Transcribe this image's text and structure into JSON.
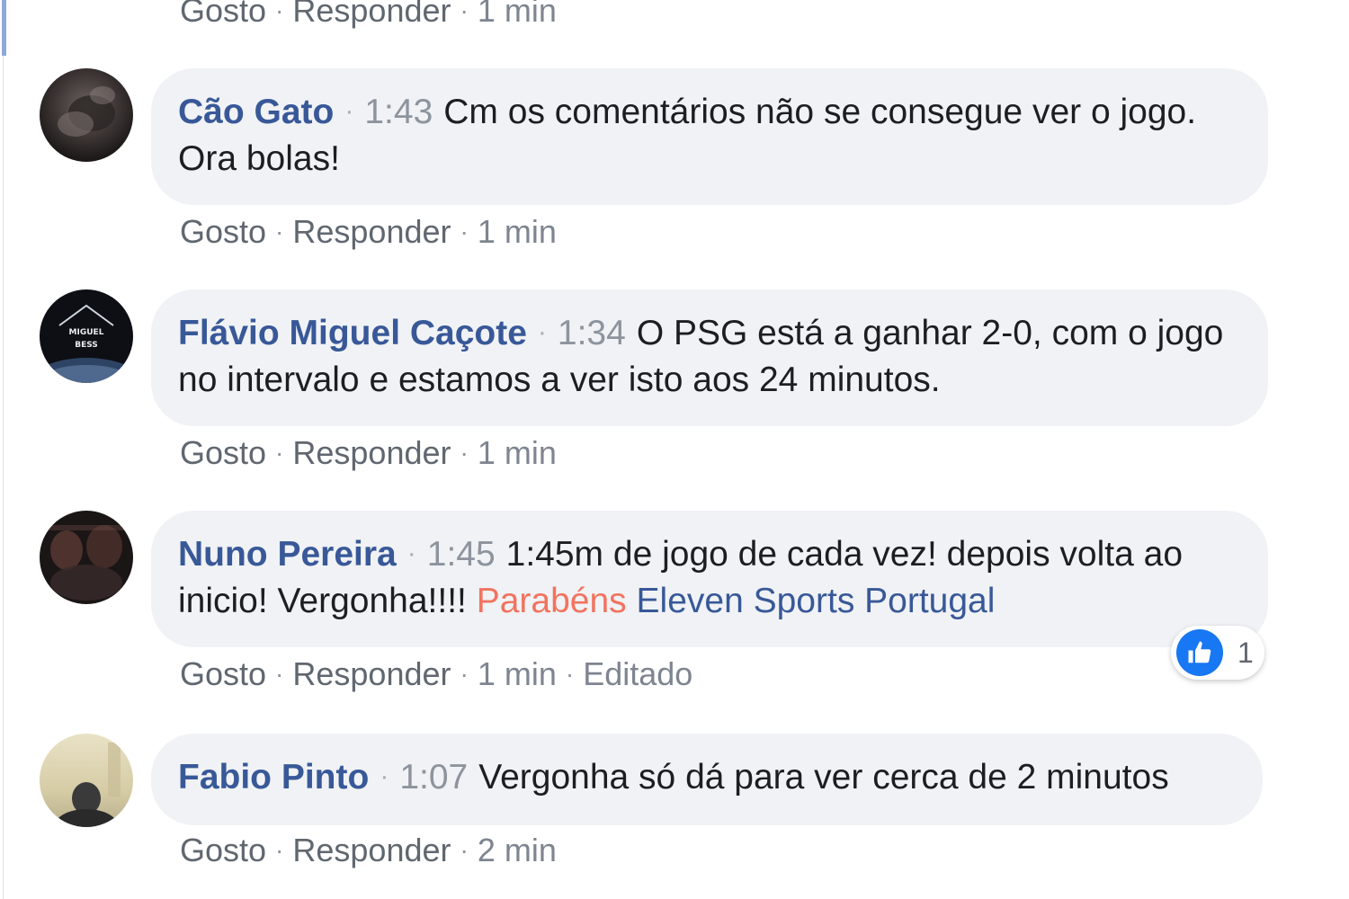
{
  "actions": {
    "like": "Gosto",
    "reply": "Responder",
    "separator": "·"
  },
  "top_partial": {
    "time_ago": "1 min"
  },
  "comments": [
    {
      "author": "Cão Gato",
      "time": "1:43",
      "text": "Cm os comentários não se consegue ver o jogo. Ora bolas!",
      "time_ago": "1 min"
    },
    {
      "author": "Flávio Miguel Caçote",
      "time": "1:34",
      "text": "O PSG está a ganhar 2-0, com o jogo no intervalo e estamos a ver isto aos 24 minutos.",
      "time_ago": "1 min",
      "avatar_text_1": "MIGUEL",
      "avatar_text_2": "BESS"
    },
    {
      "author": "Nuno Pereira",
      "time": "1:45",
      "text": "1:45m de jogo de cada vez! depois volta ao inicio! Vergonha!!!!",
      "tag_1": "Parabéns",
      "tag_2": "Eleven Sports Portugal",
      "time_ago": "1 min",
      "edited": "Editado",
      "reaction_count": "1",
      "reaction_icon": "thumbs-up-icon"
    },
    {
      "author": "Fabio Pinto",
      "time": "1:07",
      "text": "Vergonha só dá para ver cerca de 2 minutos",
      "time_ago": "2 min"
    }
  ],
  "colors": {
    "author_link": "#385898",
    "bubble_bg": "#f0f2f5",
    "tag_red": "#f2735f",
    "like_blue": "#1877f2",
    "meta_gray": "#606770"
  }
}
